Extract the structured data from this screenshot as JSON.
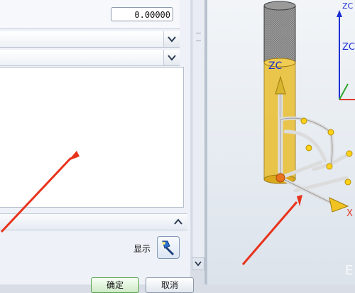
{
  "form": {
    "value_field": "0.00000",
    "ok_label": "确定",
    "cancel_label": "取消",
    "show_label": "显示"
  },
  "viewport": {
    "axis_zc": "ZC",
    "axis_zc_corner": "ZC",
    "axis_x_label": "X",
    "axis_z_top": "ZC",
    "watermark": "E"
  },
  "icons": {
    "dropdown": "chevron-down-icon",
    "collapse": "chevron-up-icon",
    "flashlight": "flashlight-icon"
  },
  "colors": {
    "cylinder": "#e9be2e",
    "axis_blue": "#1c2fd2",
    "axis_red": "#e23a28",
    "axis_green": "#2fa52f",
    "annotation_red": "#e8331c"
  }
}
